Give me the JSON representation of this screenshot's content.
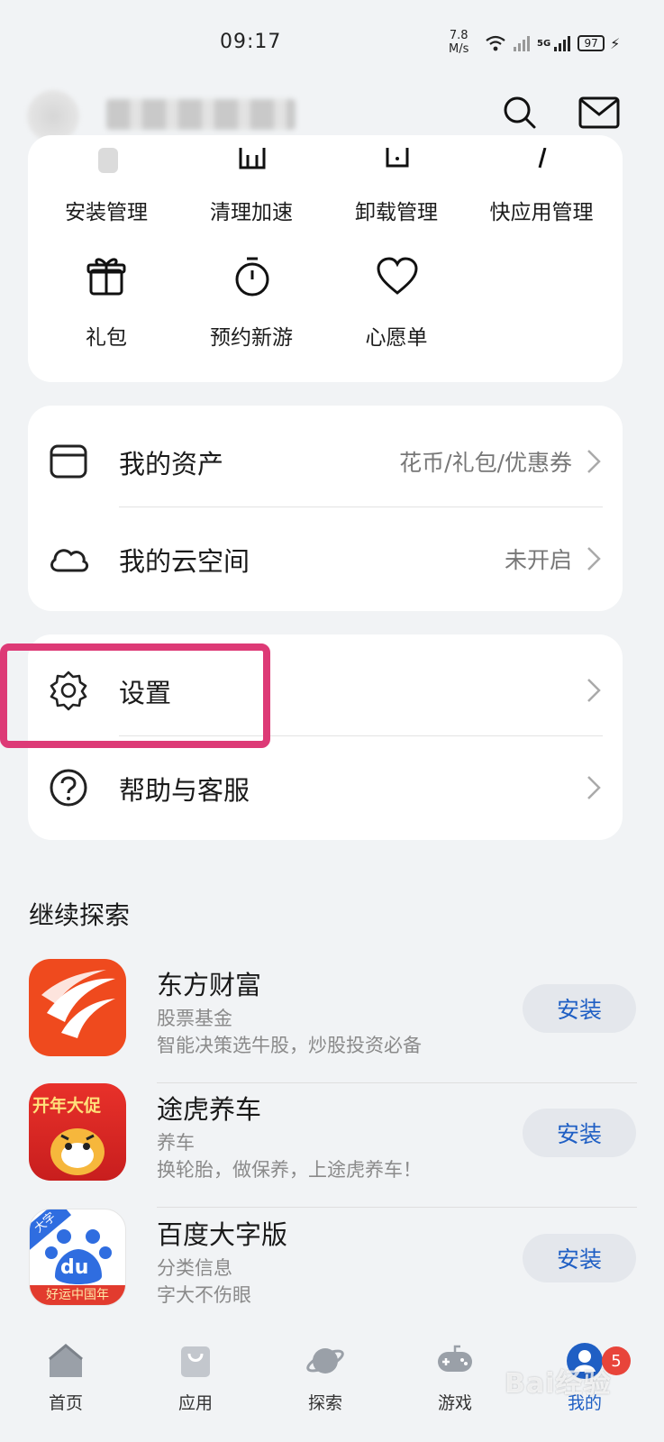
{
  "status_bar": {
    "time": "09:17",
    "speed": "7.8",
    "speed_unit": "M/s",
    "network": "5G",
    "battery": "97"
  },
  "header": {
    "search_icon": "search-icon",
    "message_icon": "mail-icon"
  },
  "tools_grid": {
    "items": [
      {
        "label": "安装管理",
        "icon": "install-icon"
      },
      {
        "label": "清理加速",
        "icon": "clean-icon"
      },
      {
        "label": "卸载管理",
        "icon": "uninstall-icon"
      },
      {
        "label": "快应用管理",
        "icon": "quick-app-icon"
      },
      {
        "label": "礼包",
        "icon": "gift-icon"
      },
      {
        "label": "预约新游",
        "icon": "stopwatch-icon"
      },
      {
        "label": "心愿单",
        "icon": "heart-icon"
      }
    ]
  },
  "assets_card": {
    "rows": [
      {
        "label": "我的资产",
        "value": "花币/礼包/优惠券",
        "icon": "wallet-icon"
      },
      {
        "label": "我的云空间",
        "value": "未开启",
        "icon": "cloud-icon"
      }
    ]
  },
  "settings_card": {
    "rows": [
      {
        "label": "设置",
        "icon": "gear-icon"
      },
      {
        "label": "帮助与客服",
        "icon": "help-icon"
      }
    ]
  },
  "explore": {
    "title": "继续探索",
    "install_label": "安装",
    "apps": [
      {
        "name": "东方财富",
        "category": "股票基金",
        "description": "智能决策选牛股，炒股投资必备"
      },
      {
        "name": "途虎养车",
        "category": "养车",
        "description": "换轮胎，做保养，上途虎养车！",
        "icon_text": "开年大促"
      },
      {
        "name": "百度大字版",
        "category": "分类信息",
        "description": "字大不伤眼",
        "icon_text_top": "大字",
        "icon_text_mid": "du",
        "icon_text_bottom": "好运中国年"
      }
    ]
  },
  "bottom_nav": {
    "items": [
      {
        "label": "首页",
        "icon": "home-icon"
      },
      {
        "label": "应用",
        "icon": "bag-icon"
      },
      {
        "label": "探索",
        "icon": "planet-icon"
      },
      {
        "label": "游戏",
        "icon": "gamepad-icon"
      },
      {
        "label": "我的",
        "icon": "profile-icon"
      }
    ],
    "badge": "5"
  },
  "watermark": "Bai经验",
  "colors": {
    "accent_blue": "#1f5fc4",
    "highlight": "#dd3a76",
    "badge": "#e8443a",
    "background": "#f1f3f5"
  }
}
